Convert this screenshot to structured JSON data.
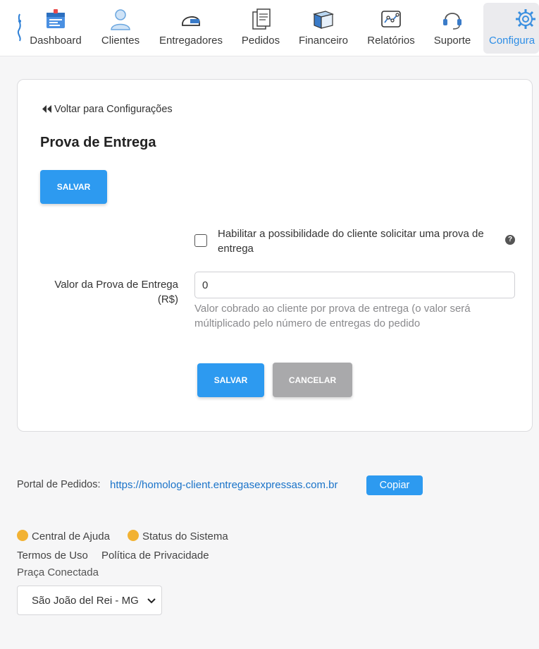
{
  "nav": {
    "items": [
      {
        "label": "Dashboard",
        "icon": "dashboard-icon"
      },
      {
        "label": "Clientes",
        "icon": "user-icon"
      },
      {
        "label": "Entregadores",
        "icon": "helmet-icon"
      },
      {
        "label": "Pedidos",
        "icon": "receipt-icon"
      },
      {
        "label": "Financeiro",
        "icon": "books-icon"
      },
      {
        "label": "Relatórios",
        "icon": "chart-icon"
      },
      {
        "label": "Suporte",
        "icon": "headset-icon"
      },
      {
        "label": "Configura",
        "icon": "gear-icon",
        "active": true
      }
    ]
  },
  "back_link": "Voltar para Configurações",
  "page_title": "Prova de Entrega",
  "save_label": "SALVAR",
  "form": {
    "checkbox_label": "Habilitar a possibilidade do cliente solicitar uma prova de entrega",
    "checkbox_checked": false,
    "help_icon": "?",
    "field_label": "Valor da Prova de Entrega (R$)",
    "field_value": "0",
    "field_help": "Valor cobrado ao cliente por prova de entrega (o valor será múltiplicado pelo número de entregas do pedido",
    "save_label": "SALVAR",
    "cancel_label": "CANCELAR"
  },
  "footer": {
    "portal_label": "Portal de Pedidos:",
    "portal_url": "https://homolog-client.entregasexpressas.com.br",
    "copy_label": "Copiar",
    "help_center": "Central de Ajuda",
    "system_status": "Status do Sistema",
    "terms": "Termos de Uso",
    "privacy": "Política de Privacidade",
    "praca_label": "Praça Conectada",
    "praca_value": "São João del Rei - MG"
  },
  "colors": {
    "primary": "#2d9af0",
    "secondary": "#a9a9ab",
    "link": "#1a73c9",
    "active_nav": "#2e8ee6"
  }
}
